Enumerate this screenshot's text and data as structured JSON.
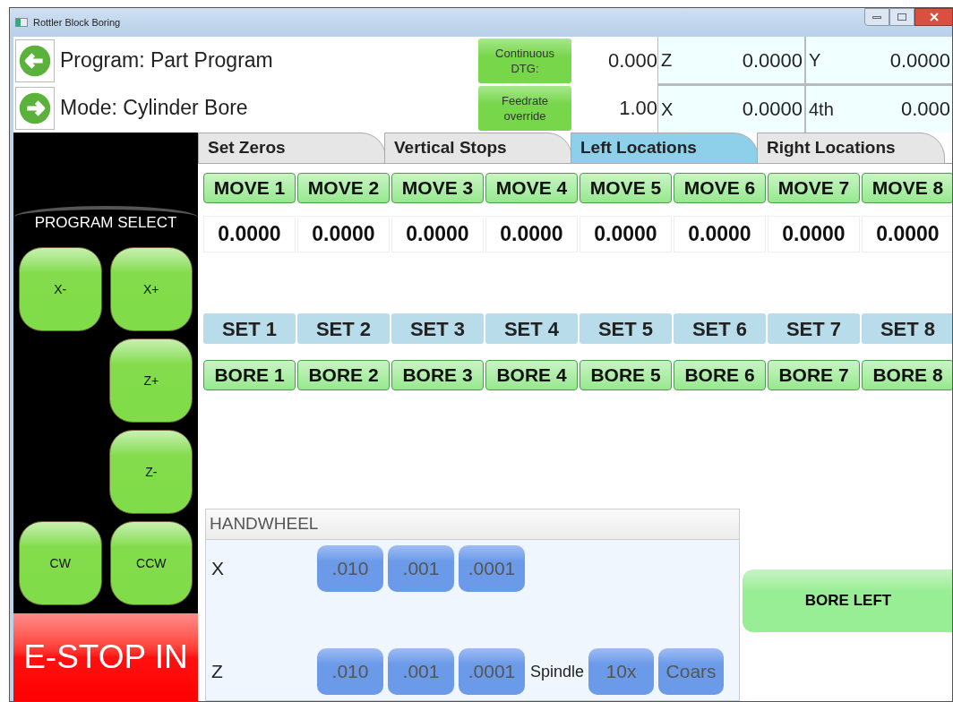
{
  "window": {
    "title": "Rottler Block Boring"
  },
  "header": {
    "rows": [
      {
        "text": "Program: Part Program",
        "kind": "back",
        "readout_label": "Continuous DTG:",
        "readout_value": "0.000"
      },
      {
        "text": "Mode: Cylinder Bore",
        "kind": "forward",
        "readout_label": "Feedrate override",
        "readout_value": "1.00"
      }
    ],
    "axes": [
      {
        "axis": "Z",
        "value": "0.0000"
      },
      {
        "axis": "Y",
        "value": "0.0000"
      },
      {
        "axis": "X",
        "value": "0.0000"
      },
      {
        "axis": "4th",
        "value": "0.000"
      }
    ]
  },
  "jog_panel": {
    "title": "PROGRAM SELECT",
    "rows": [
      {
        "left": "X-",
        "right": "X+"
      },
      {
        "right": "Z+"
      },
      {
        "right": "Z-"
      },
      {
        "left": "CW",
        "right": "CCW"
      }
    ],
    "estop": "E-STOP IN"
  },
  "tabs": [
    {
      "label": "Set Zeros",
      "selected": false
    },
    {
      "label": "Vertical Stops",
      "selected": false
    },
    {
      "label": "Left Locations",
      "selected": true
    },
    {
      "label": "Right Locations",
      "selected": false
    }
  ],
  "locations": [
    {
      "move": "MOVE 1",
      "value": "0.0000",
      "set": "SET 1",
      "bore": "BORE 1"
    },
    {
      "move": "MOVE 2",
      "value": "0.0000",
      "set": "SET 2",
      "bore": "BORE 2"
    },
    {
      "move": "MOVE 3",
      "value": "0.0000",
      "set": "SET 3",
      "bore": "BORE 3"
    },
    {
      "move": "MOVE 4",
      "value": "0.0000",
      "set": "SET 4",
      "bore": "BORE 4"
    },
    {
      "move": "MOVE 5",
      "value": "0.0000",
      "set": "SET 5",
      "bore": "BORE 5"
    },
    {
      "move": "MOVE 6",
      "value": "0.0000",
      "set": "SET 6",
      "bore": "BORE 6"
    },
    {
      "move": "MOVE 7",
      "value": "0.0000",
      "set": "SET 7",
      "bore": "BORE 7"
    },
    {
      "move": "MOVE 8",
      "value": "0.0000",
      "set": "SET 8",
      "bore": "BORE 8"
    }
  ],
  "handwheel": {
    "title": "HANDWHEEL",
    "rows": [
      {
        "axis": "X",
        "steps": [
          ".010",
          ".001",
          ".0001"
        ]
      },
      {
        "axis": "Z",
        "steps": [
          ".010",
          ".001",
          ".0001"
        ],
        "extra_label": "Spindle",
        "extra_buttons": [
          "10x",
          "Coars"
        ]
      }
    ]
  },
  "bore_button": "BORE LEFT"
}
